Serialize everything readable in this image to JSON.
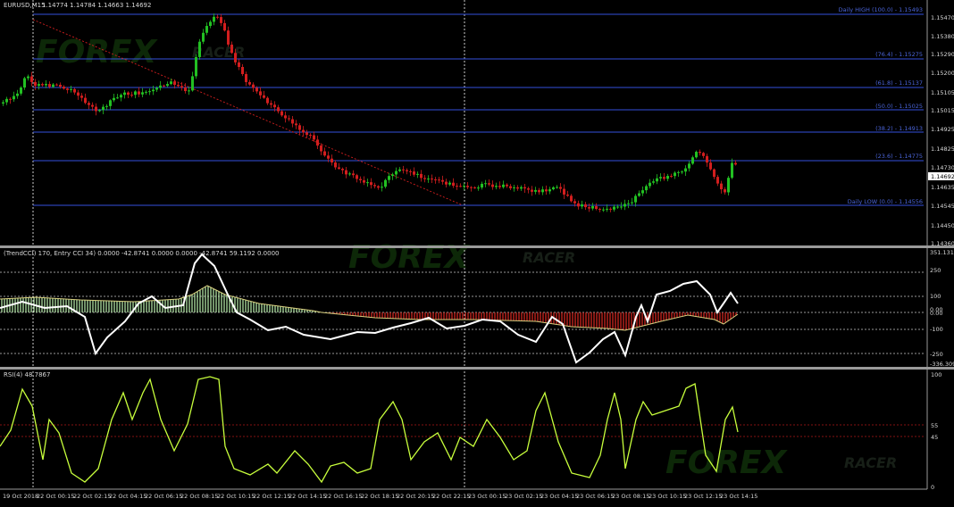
{
  "window": {
    "title": "EURUSD,M15",
    "ohlc": "1.14774 1.14784 1.14663 1.14692"
  },
  "price_axis": {
    "labels": [
      "1.15470",
      "1.15380",
      "1.15290",
      "1.15200",
      "1.15105",
      "1.15015",
      "1.14925",
      "1.14825",
      "1.14730",
      "1.14635",
      "1.14545",
      "1.14450",
      "1.14360"
    ],
    "current": "1.14692"
  },
  "fib_levels": [
    {
      "label": "Daily HIGH (100.0) - 1.15493"
    },
    {
      "label": "(76.4) - 1.15275"
    },
    {
      "label": "(61.8) - 1.15137"
    },
    {
      "label": "(50.0) - 1.15025"
    },
    {
      "label": "(38.2) - 1.14913"
    },
    {
      "label": "(23.6) - 1.14775"
    },
    {
      "label": "Daily LOW (0.0) - 1.14556"
    }
  ],
  "cci_panel": {
    "title": "(TrendCCI) 170, Entry CCI 34) 0.0000 -42.8741 0.0000 0.0000 -42.8741 59.1192 0.0000",
    "axis_labels": [
      "351.1311",
      "250",
      "100",
      "0.00",
      "0.00",
      "-100",
      "-250",
      "-336.3098"
    ]
  },
  "rsi_panel": {
    "title": "RSI(4) 48.7867",
    "axis_labels": [
      "100",
      "55",
      "45",
      "0"
    ]
  },
  "time_axis": [
    "19 Oct 2018",
    "22 Oct 00:15",
    "22 Oct 02:15",
    "22 Oct 04:15",
    "22 Oct 06:15",
    "22 Oct 08:15",
    "22 Oct 10:15",
    "22 Oct 12:15",
    "22 Oct 14:15",
    "22 Oct 16:15",
    "22 Oct 18:15",
    "22 Oct 20:15",
    "22 Oct 22:15",
    "23 Oct 00:15",
    "23 Oct 02:15",
    "23 Oct 04:15",
    "23 Oct 06:15",
    "23 Oct 08:15",
    "23 Oct 10:15",
    "23 Oct 12:15",
    "23 Oct 14:15"
  ],
  "watermark": {
    "brand": "FOREX",
    "sub": "RACER"
  },
  "colors": {
    "bull": "#22c022",
    "bear": "#d21e1e",
    "fib": "#3550dc",
    "grid": "#ffffff",
    "cci": "#ffffff",
    "trend_up": "#bff5b0",
    "trend_down": "#e02a22",
    "rsi": "#c8ff3c",
    "level": "#b01818"
  }
}
